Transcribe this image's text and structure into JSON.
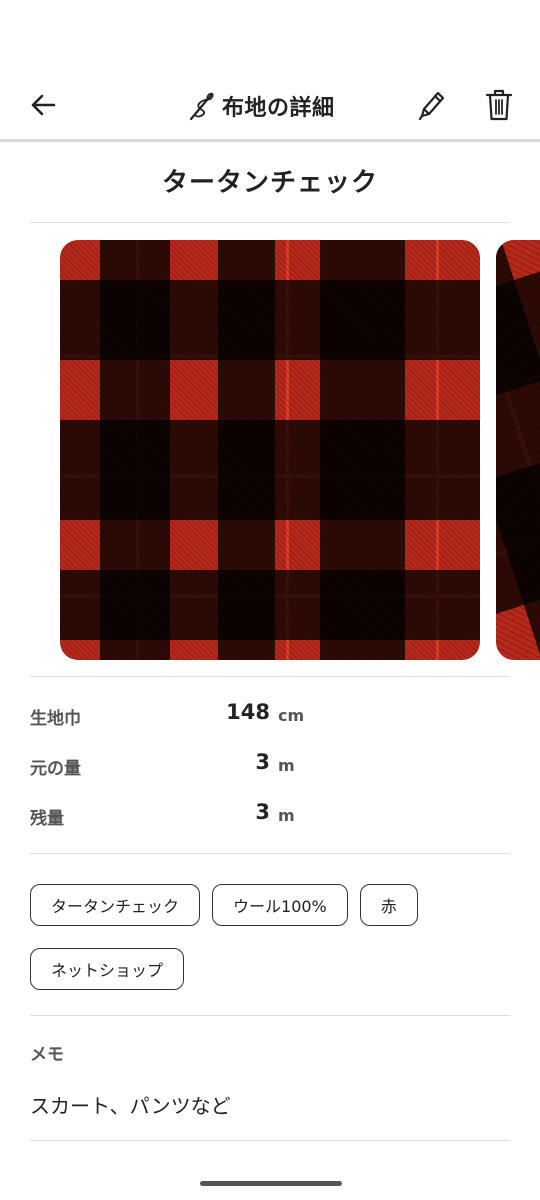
{
  "app_bar": {
    "title": "布地の詳細",
    "icons": {
      "back": "arrow-left-icon",
      "title": "needle-thread-icon",
      "edit": "pencil-icon",
      "delete": "trash-icon"
    }
  },
  "fabric": {
    "name": "タータンチェック",
    "photos": [
      "tartan-photo-1",
      "tartan-photo-2"
    ]
  },
  "specs": [
    {
      "label": "生地巾",
      "value": "148",
      "unit": "cm"
    },
    {
      "label": "元の量",
      "value": "3",
      "unit": "m"
    },
    {
      "label": "残量",
      "value": "3",
      "unit": "m"
    }
  ],
  "tags": [
    "タータンチェック",
    "ウール100%",
    "赤",
    "ネットショップ"
  ],
  "memo": {
    "label": "メモ",
    "text": "スカート、パンツなど"
  },
  "colors": {
    "accent": "#b8281a",
    "text": "#222222",
    "label": "#555555"
  }
}
